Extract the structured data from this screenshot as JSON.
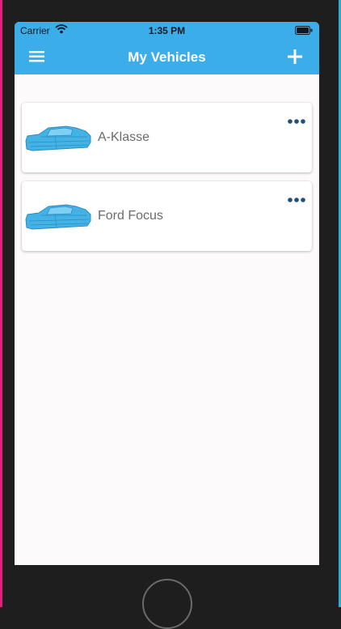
{
  "status_bar": {
    "carrier": "Carrier",
    "time": "1:35 PM",
    "wifi_icon": "wifi-icon",
    "battery_icon": "battery-icon"
  },
  "nav_bar": {
    "title": "My Vehicles",
    "menu_icon": "hamburger-menu-icon",
    "add_icon": "plus-icon",
    "background_color": "#3baee9"
  },
  "vehicles": [
    {
      "name": "A-Klasse",
      "icon": "car-icon",
      "menu_icon": "more-options-icon"
    },
    {
      "name": "Ford Focus",
      "icon": "car-icon",
      "menu_icon": "more-options-icon"
    }
  ],
  "colors": {
    "accent": "#3baee9",
    "car_fill": "#43b3e6",
    "more_dots": "#1f4f7e",
    "text": "#6b6b6b"
  }
}
